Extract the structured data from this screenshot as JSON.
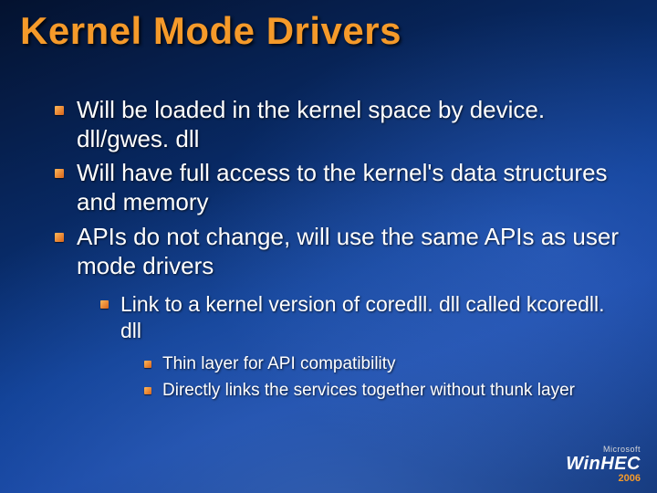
{
  "title": "Kernel Mode Drivers",
  "bullets": {
    "l1": [
      "Will be loaded in the kernel space by device. dll/gwes. dll",
      "Will have full access to the kernel's data structures and memory",
      "APIs do not change, will use the same APIs as user mode drivers"
    ],
    "l2": [
      "Link to a kernel version of coredll. dll called kcoredll. dll"
    ],
    "l3": [
      "Thin layer for API compatibility",
      "Directly links the services together without thunk layer"
    ]
  },
  "branding": {
    "company": "Microsoft",
    "product": "WinHEC",
    "year": "2006"
  }
}
